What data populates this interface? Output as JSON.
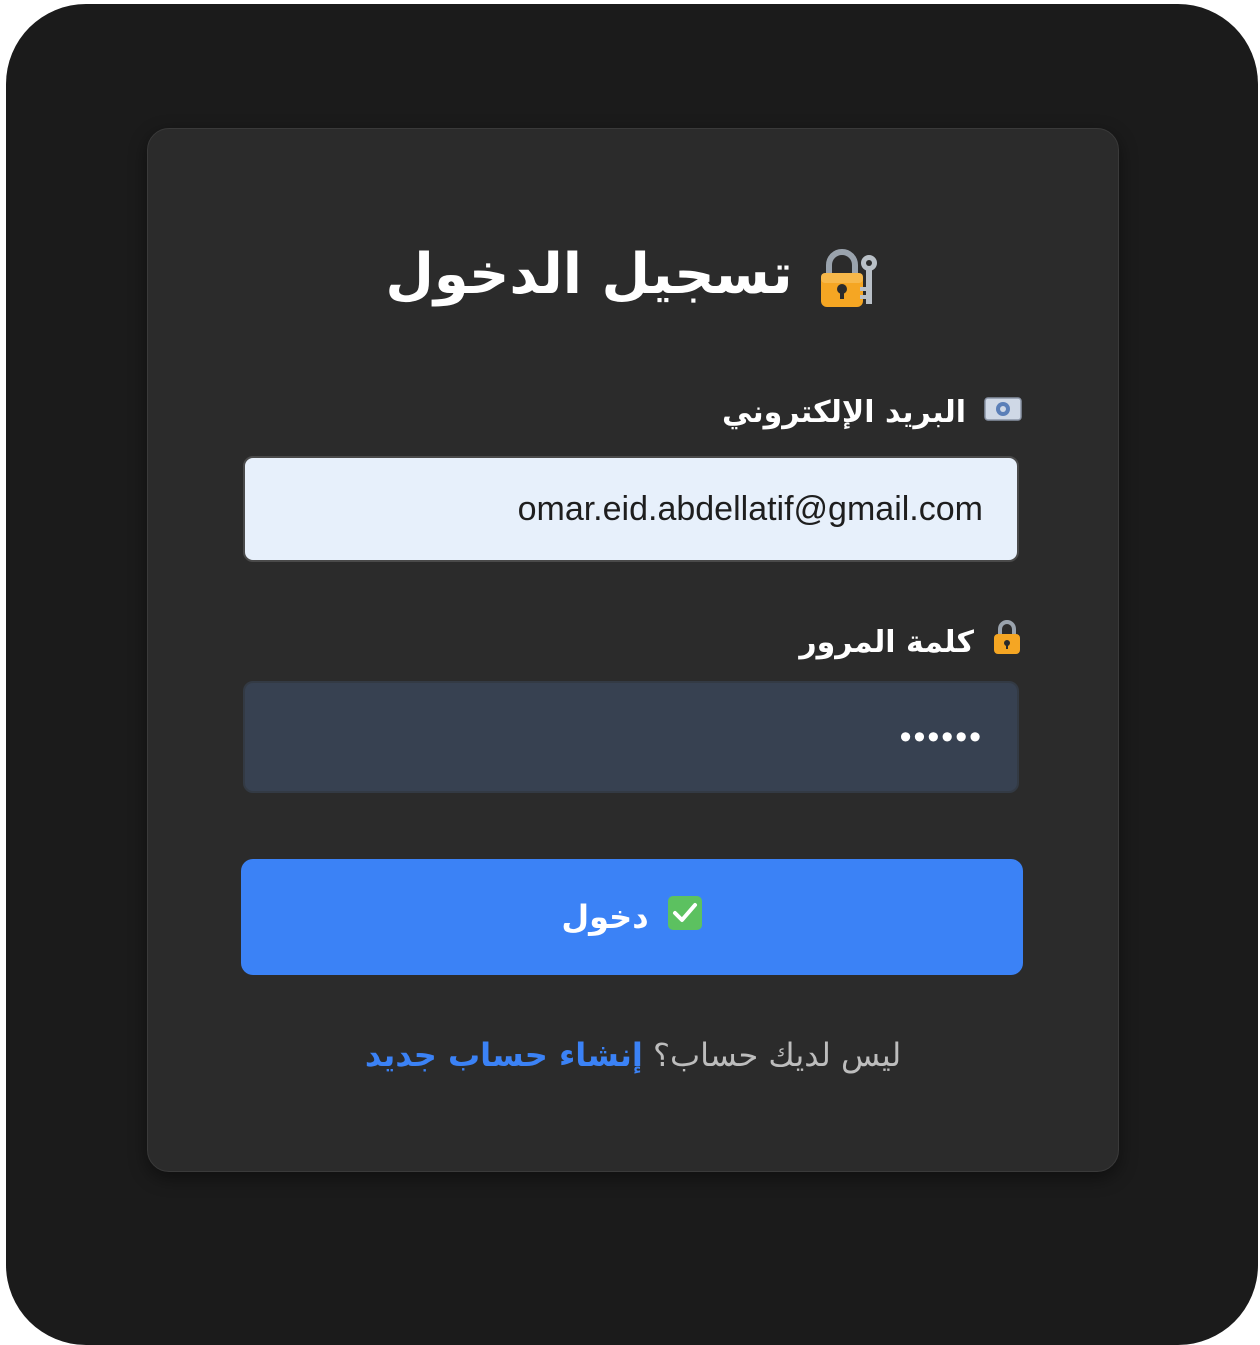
{
  "login": {
    "title": "تسجيل الدخول",
    "title_icon": "lock-with-key-icon",
    "email": {
      "label": "البريد الإلكتروني",
      "label_icon": "envelope-icon",
      "value": "omar.eid.abdellatif@gmail.com"
    },
    "password": {
      "label": "كلمة المرور",
      "label_icon": "lock-icon",
      "value": "••••••"
    },
    "submit": {
      "label": "دخول",
      "icon": "check-mark-icon"
    },
    "signup": {
      "prompt": "ليس لديك حساب؟",
      "link": "إنشاء حساب جديد"
    }
  },
  "colors": {
    "background": "#1b1b1b",
    "card": "#2b2b2b",
    "accent": "#3b82f6",
    "email_input_bg": "#e7f0fb",
    "password_input_bg": "#374151"
  }
}
